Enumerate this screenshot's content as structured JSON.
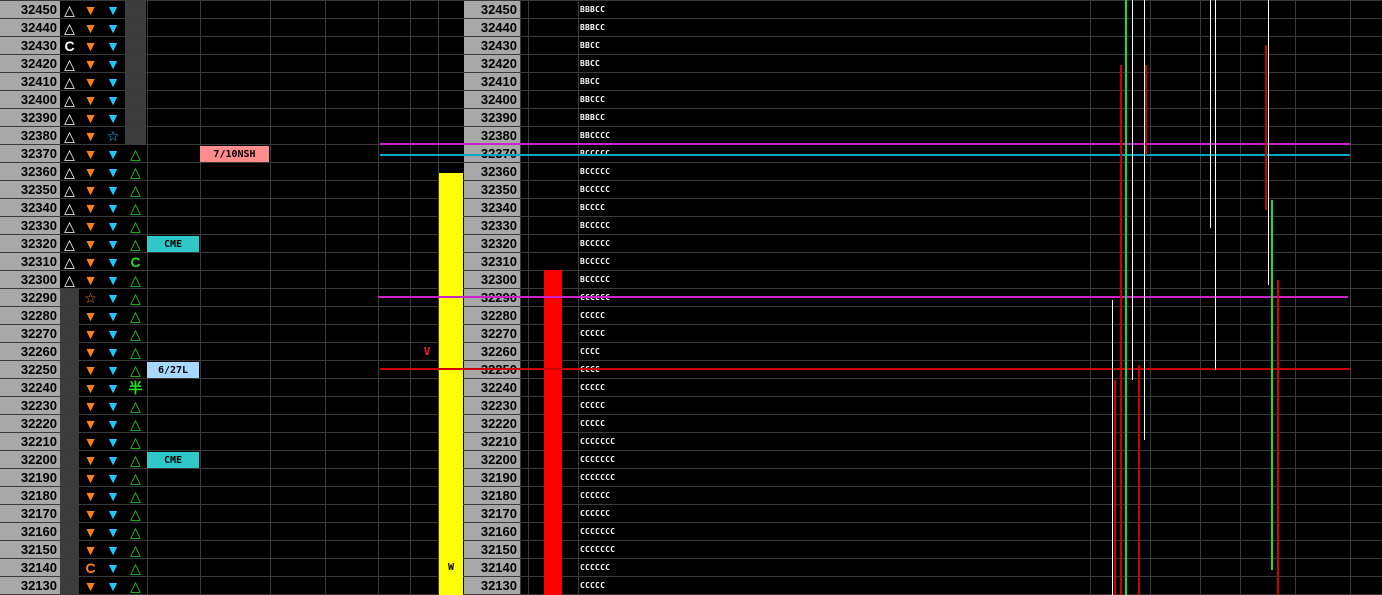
{
  "ladder": {
    "prices": [
      "32450",
      "32440",
      "32430",
      "32420",
      "32410",
      "32400",
      "32390",
      "32380",
      "32370",
      "32360",
      "32350",
      "32340",
      "32330",
      "32320",
      "32310",
      "32300",
      "32290",
      "32280",
      "32270",
      "32260",
      "32250",
      "32240",
      "32230",
      "32220",
      "32210",
      "32200",
      "32190",
      "32180",
      "32170",
      "32160",
      "32150",
      "32140",
      "32130"
    ],
    "col1": [
      "△",
      "△",
      "C",
      "△",
      "△",
      "△",
      "△",
      "△",
      "△",
      "△",
      "△",
      "△",
      "△",
      "△",
      "△",
      "△",
      "",
      "",
      "",
      "",
      "",
      "",
      "",
      "",
      "",
      "",
      "",
      "",
      "",
      "",
      "",
      "",
      ""
    ],
    "col2": [
      "▼",
      "▼",
      "▼",
      "▼",
      "▼",
      "▼",
      "▼",
      "▼",
      "▼",
      "▼",
      "▼",
      "▼",
      "▼",
      "▼",
      "▼",
      "▼",
      "☆",
      "▼",
      "▼",
      "▼",
      "▼",
      "▼",
      "▼",
      "▼",
      "▼",
      "▼",
      "▼",
      "▼",
      "▼",
      "▼",
      "▼",
      "C",
      "▼"
    ],
    "col3": [
      "▼",
      "▼",
      "▼",
      "▼",
      "▼",
      "▼",
      "▼",
      "☆",
      "▼",
      "▼",
      "▼",
      "▼",
      "▼",
      "▼",
      "▼",
      "▼",
      "▼",
      "▼",
      "▼",
      "▼",
      "▼",
      "▼",
      "▼",
      "▼",
      "▼",
      "▼",
      "▼",
      "▼",
      "▼",
      "▼",
      "▼",
      "▼",
      "▼"
    ],
    "col4": [
      "",
      "",
      "",
      "",
      "",
      "",
      "",
      "",
      "△",
      "△",
      "△",
      "△",
      "△",
      "△",
      "C",
      "△",
      "△",
      "△",
      "△",
      "△",
      "△",
      "半",
      "△",
      "△",
      "△",
      "△",
      "△",
      "△",
      "△",
      "△",
      "△",
      "△",
      "△"
    ]
  },
  "tpo_letters": [
    "BBBCC",
    "BBBCC",
    "BBCC",
    "BBCC",
    "BBCC",
    "BBCCC",
    "BBBCC",
    "BBCCCC",
    "BCCCCC",
    "BCCCCC",
    "BCCCCC",
    "BCCCC",
    "BCCCCC",
    "BCCCCC",
    "BCCCCC",
    "BCCCCC",
    "CCCCCC",
    "CCCCC",
    "CCCCC",
    "CCCC",
    "CCCC",
    "CCCCC",
    "CCCCC",
    "CCCCC",
    "CCCCCCC",
    "CCCCCCC",
    "CCCCCCC",
    "CCCCCC",
    "CCCCCC",
    "CCCCCCC",
    "CCCCCCC",
    "CCCCCC",
    "CCCCC"
  ],
  "labels": {
    "nsh": "7/10NSH",
    "cme1": "CME",
    "cme2": "CME",
    "l627": "6/27L",
    "v_marker": "V",
    "w_marker": "W"
  },
  "colors": {
    "price_bg": "#a8a8a8",
    "up_triangle": "#ffffff",
    "down_orange": "#ff7f1f",
    "down_cyan": "#1ec8ff",
    "up_green": "#22dd22",
    "volume_bar": "#ffff00",
    "red_bar": "#ff0000",
    "magenta_line": "#cc22cc",
    "cyan_line": "#00a8c8",
    "red_line": "#cc0000",
    "nsh_bg": "#ff8c8c",
    "cme_bg": "#2ec8c8",
    "l627_bg": "#a8d8ff"
  },
  "indicators": {
    "yellow_bar_top_price": "32355",
    "red_bar_top_price": "32305"
  }
}
